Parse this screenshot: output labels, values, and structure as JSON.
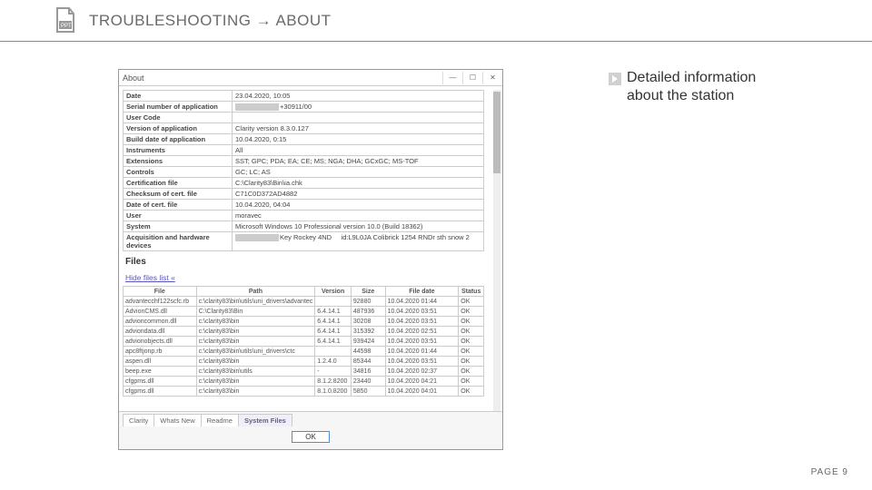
{
  "header": {
    "breadcrumb": "TROUBLESHOOTING → ABOUT"
  },
  "note": {
    "line1": "Detailed information",
    "line2": "about the station"
  },
  "page": {
    "label": "PAGE 9"
  },
  "window": {
    "title": "About",
    "tabs": [
      "Clarity",
      "Whats New",
      "Readme",
      "System Files"
    ],
    "active_tab": 3,
    "ok_label": "OK",
    "files_heading": "Files",
    "hide_link": "Hide files list «",
    "info": [
      {
        "k": "Date",
        "v": "23.04.2020, 10:05"
      },
      {
        "k": "Serial number of application",
        "v": "REDACT+30911/00"
      },
      {
        "k": "User Code",
        "v": ""
      },
      {
        "k": "Version of application",
        "v": "Clarity version 8.3.0.127"
      },
      {
        "k": "Build date of application",
        "v": "10.04.2020, 0:15"
      },
      {
        "k": "Instruments",
        "v": "All"
      },
      {
        "k": "Extensions",
        "v": "SST; GPC; PDA; EA; CE; MS; NGA; DHA; GCxGC; MS-TOF"
      },
      {
        "k": "Controls",
        "v": "GC; LC; AS"
      },
      {
        "k": "Certification file",
        "v": "C:\\Clarity83\\Bin\\ia.chk"
      },
      {
        "k": "Checksum of cert. file",
        "v": "C71C0D372AD4882"
      },
      {
        "k": "Date of cert. file",
        "v": "10.04.2020, 04:04"
      },
      {
        "k": "User",
        "v": "moravec"
      },
      {
        "k": "System",
        "v": "Microsoft Windows 10 Professional version 10.0 (Build 18362)"
      },
      {
        "k": "Acquisition and hardware devices",
        "v": "Key Rockey 4ND   REDACT  id:L9L0JA\nColibrick 1254\nRNDr sth snow 2"
      }
    ],
    "files_columns": [
      "File",
      "Path",
      "Version",
      "Size",
      "File date",
      "Status"
    ],
    "files": [
      {
        "f": "advantecchf122scfc.rb",
        "p": "c:\\clarity83\\bin\\utils\\uni_drivers\\advantec",
        "v": "",
        "s": "92880",
        "d": "10.04.2020 01:44",
        "st": "OK"
      },
      {
        "f": "AdvionCMS.dll",
        "p": "C:\\Clarity83\\Bin",
        "v": "6.4.14.1",
        "s": "487936",
        "d": "10.04.2020 03:51",
        "st": "OK"
      },
      {
        "f": "advioncommon.dll",
        "p": "c:\\clarity83\\bin",
        "v": "6.4.14.1",
        "s": "30208",
        "d": "10.04.2020 03:51",
        "st": "OK"
      },
      {
        "f": "adviondata.dll",
        "p": "c:\\clarity83\\bin",
        "v": "6.4.14.1",
        "s": "315392",
        "d": "10.04.2020 02:51",
        "st": "OK"
      },
      {
        "f": "advionobjects.dll",
        "p": "c:\\clarity83\\bin",
        "v": "6.4.14.1",
        "s": "939424",
        "d": "10.04.2020 03:51",
        "st": "OK"
      },
      {
        "f": "apc8ftjonp.rb",
        "p": "c:\\clarity83\\bin\\utils\\uni_drivers\\ctc",
        "v": "",
        "s": "44598",
        "d": "10.04.2020 01:44",
        "st": "OK"
      },
      {
        "f": "aspen.dll",
        "p": "c:\\clarity83\\bin",
        "v": "1.2.4.0",
        "s": "85344",
        "d": "10.04.2020 03:51",
        "st": "OK"
      },
      {
        "f": "beep.exe",
        "p": "c:\\clarity83\\bin\\utils",
        "v": "-",
        "s": "34816",
        "d": "10.04.2020 02:37",
        "st": "OK"
      },
      {
        "f": "cfgpms.dll",
        "p": "c:\\clarity83\\bin",
        "v": "8.1.2.8200",
        "s": "23440",
        "d": "10.04.2020 04:21",
        "st": "OK"
      },
      {
        "f": "cfgpms.dll",
        "p": "c:\\clarity83\\bin",
        "v": "8.1.0.8200",
        "s": "5850",
        "d": "10.04.2020 04:01",
        "st": "OK"
      }
    ]
  }
}
